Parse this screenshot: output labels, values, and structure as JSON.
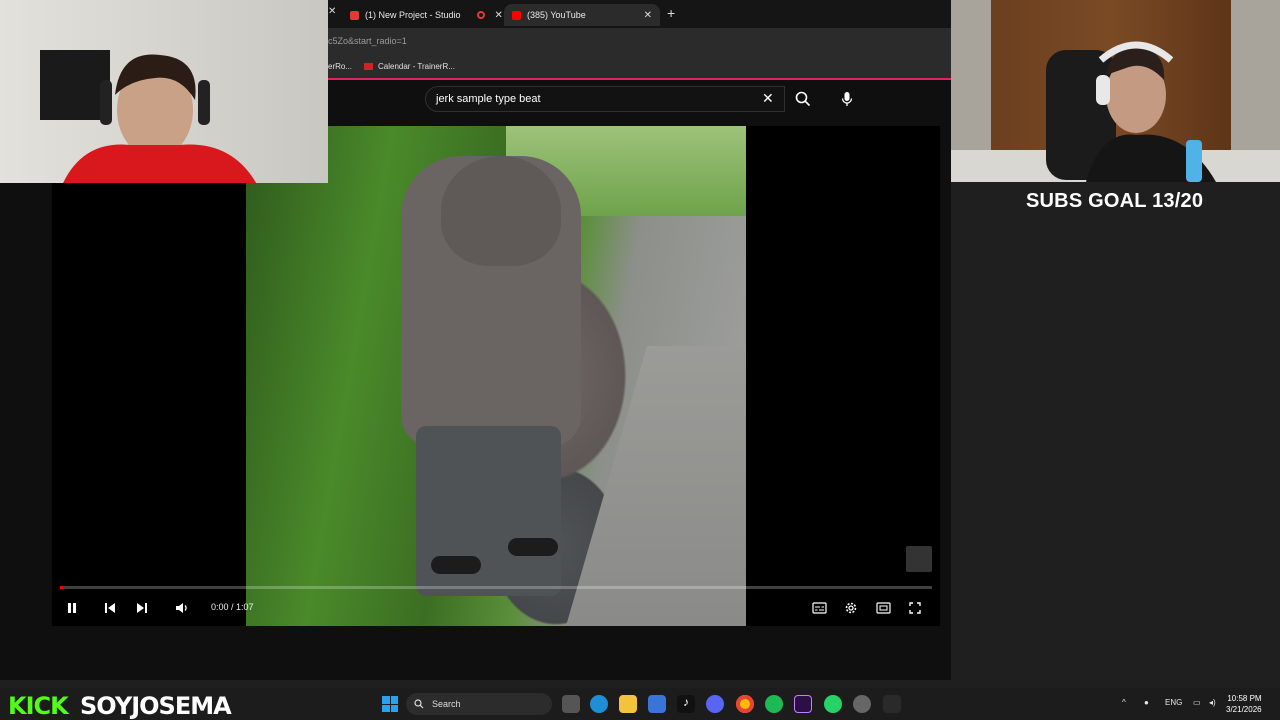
{
  "browser": {
    "tabs": [
      {
        "label": "(1) New Project - Studio",
        "favicon_color": "#e53935",
        "active": false
      },
      {
        "label": "(385) YouTube",
        "favicon_color": "#ff0000",
        "active": true
      }
    ],
    "url_fragment": "c5Zo&start_radio=1",
    "bookmarks": [
      "erRo...",
      "Calendar - TrainerR..."
    ]
  },
  "youtube": {
    "search_query": "jerk sample type beat",
    "player": {
      "current_time": "0:00 / 1:07",
      "progress_fraction": 0.0
    }
  },
  "overlay": {
    "subs_goal": "SUBS GOAL 13/20"
  },
  "taskbar": {
    "kick_label": "KICK",
    "channel_name": "SOYJOSEMA",
    "search_label": "Search",
    "language": "ENG",
    "time": "10:58 PM",
    "date": "3/21/2026"
  }
}
